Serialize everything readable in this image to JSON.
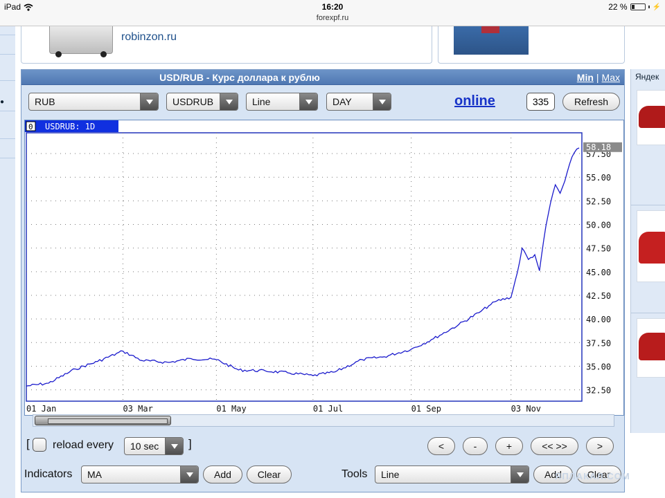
{
  "status_bar": {
    "device": "iPad",
    "time": "16:20",
    "url": "forexpf.ru",
    "battery": "22 %",
    "battery_level": 0.22
  },
  "ads": {
    "left_link": "robinzon.ru"
  },
  "sidebar_right": {
    "title": "Яндек"
  },
  "widget": {
    "title": "USD/RUB - Курс доллара к рублю",
    "min_label": "Min",
    "sep": "|",
    "max_label": "Max",
    "selects": {
      "currency": "RUB",
      "symbol": "USDRUB",
      "chart_type": "Line",
      "period": "DAY"
    },
    "online_label": "online",
    "count_value": "335",
    "refresh_label": "Refresh",
    "reload": {
      "bracket_open": "[",
      "label": "reload every",
      "interval": "10 sec",
      "bracket_close": "]"
    },
    "nav_buttons": [
      "<",
      "-",
      "+",
      "<< >>",
      ">"
    ],
    "indicators": {
      "label": "Indicators",
      "value": "MA",
      "add_label": "Add",
      "clear_label": "Clear"
    },
    "tools": {
      "label": "Tools",
      "value": "Line",
      "add_label": "Add",
      "clear_label": "Clear"
    },
    "watermark": "ЯПЛАКАЛ.COM"
  },
  "chart_data": {
    "type": "line",
    "legend_index": "0",
    "legend_label": "USDRUB: 1D",
    "last_value_label": "58.18",
    "x_tick_labels": [
      "01 Jan",
      "03 Mar",
      "01 May",
      "01 Jul",
      "01 Sep",
      "03 Nov"
    ],
    "y_tick_labels": [
      "57.50",
      "55.00",
      "52.50",
      "50.00",
      "47.50",
      "45.00",
      "42.50",
      "40.00",
      "37.50",
      "35.00",
      "32.50"
    ],
    "ylim": [
      31.3,
      59.7
    ],
    "grid": true,
    "color": "#1a1acc",
    "series": [
      {
        "x": [
          "01 Jan",
          "15 Jan",
          "01 Feb",
          "15 Feb",
          "03 Mar",
          "15 Mar",
          "01 Apr",
          "15 Apr",
          "01 May",
          "15 May",
          "01 Jun",
          "15 Jun",
          "01 Jul",
          "15 Jul",
          "01 Aug",
          "15 Aug",
          "01 Sep",
          "15 Sep",
          "01 Oct",
          "15 Oct",
          "20 Oct",
          "25 Oct",
          "03 Nov",
          "07 Nov",
          "10 Nov",
          "14 Nov",
          "18 Nov",
          "21 Nov",
          "25 Nov",
          "28 Nov",
          "01 Dec",
          "04 Dec",
          "07 Dec",
          "10 Dec",
          "13 Dec",
          "16 Dec"
        ],
        "values": [
          32.9,
          33.2,
          34.7,
          35.5,
          36.6,
          35.6,
          35.4,
          35.8,
          35.7,
          34.6,
          34.5,
          34.3,
          34.0,
          34.4,
          35.7,
          36.0,
          36.8,
          37.9,
          39.4,
          40.8,
          41.4,
          41.9,
          42.3,
          44.9,
          47.5,
          46.3,
          46.8,
          45.1,
          49.8,
          52.3,
          54.2,
          53.3,
          54.6,
          56.4,
          57.6,
          58.1
        ]
      }
    ]
  }
}
